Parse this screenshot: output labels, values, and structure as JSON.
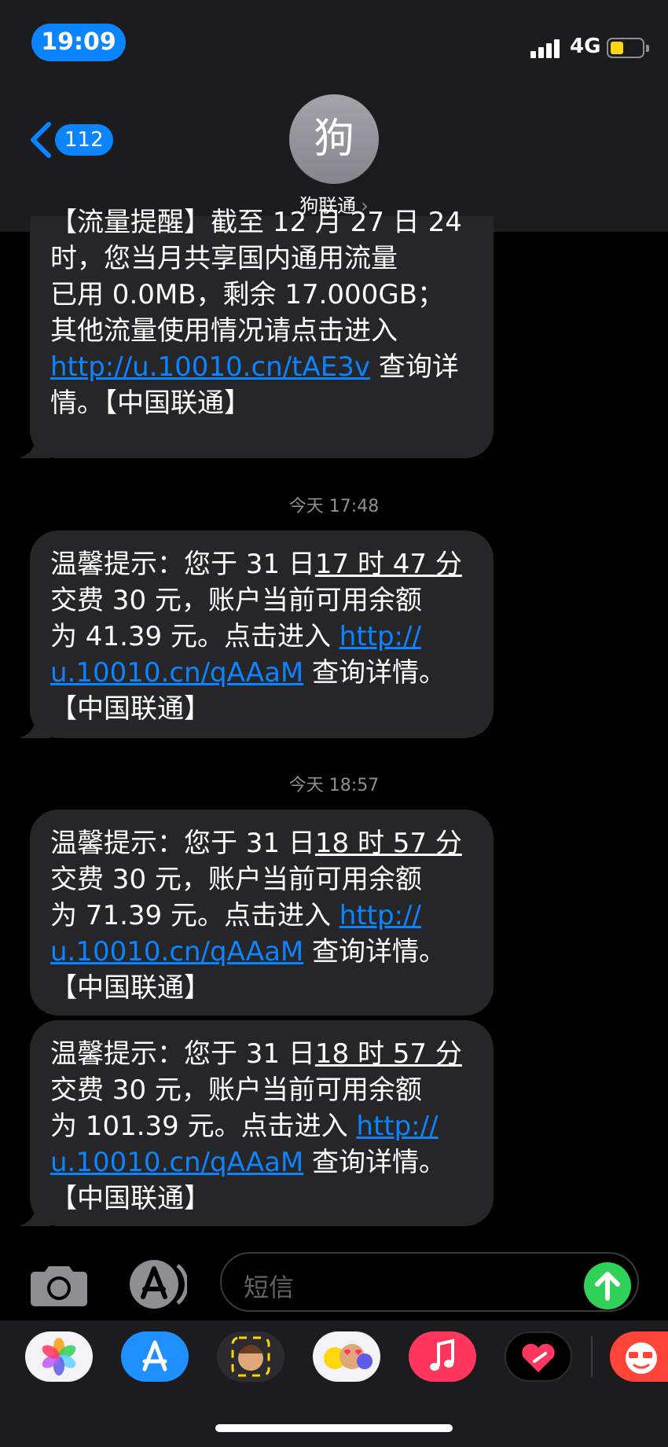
{
  "status": {
    "time": "19:09",
    "network": "4G",
    "battery_color": "#ffd60a"
  },
  "header": {
    "back_count": "112",
    "avatar_initial": "狗",
    "contact_name": "狗联通"
  },
  "messages": [
    {
      "l1": "【流量提醒】截至 12 月 27 日 24",
      "l2": "时，您当月共享国内通用流量",
      "l3": "已用 0.0MB，剩余 17.000GB；",
      "l4": "其他流量使用情况请点击进入",
      "link": "http://u.10010.cn/tAE3v",
      "l5_rest": " 查询详",
      "l6": "情。【中国联通】"
    },
    {
      "timestamp": "今天 17:48",
      "l1_pre": "温馨提示：您于 31 日",
      "l1_time": "17 时 47 分",
      "l2": "交费 30 元，账户当前可用余额",
      "l3_pre": "为 41.39 元。点击进入 ",
      "link_a": "http://",
      "link_b": "u.10010.cn/qAAaM",
      "l4_rest": " 查询详情。",
      "l5": "【中国联通】"
    },
    {
      "timestamp": "今天 18:57",
      "l1_pre": "温馨提示：您于 31 日",
      "l1_time": "18 时 57 分",
      "l2": "交费 30 元，账户当前可用余额",
      "l3_pre": "为 71.39 元。点击进入 ",
      "link_a": "http://",
      "link_b": "u.10010.cn/qAAaM",
      "l4_rest": " 查询详情。",
      "l5": "【中国联通】"
    },
    {
      "l1_pre": "温馨提示：您于 31 日",
      "l1_time": "18 时 57 分",
      "l2": "交费 30 元，账户当前可用余额",
      "l3_pre": "为 101.39 元。点击进入 ",
      "link_a": "http://",
      "link_b": "u.10010.cn/qAAaM",
      "l4_rest": " 查询详情。",
      "l5": "【中国联通】"
    }
  ],
  "input": {
    "placeholder": "短信"
  },
  "drawer": {
    "apps": [
      "photos-icon",
      "app-store-icon",
      "memoji-icon",
      "animoji-icon",
      "music-icon",
      "digital-touch-icon",
      "stickers-icon"
    ]
  }
}
